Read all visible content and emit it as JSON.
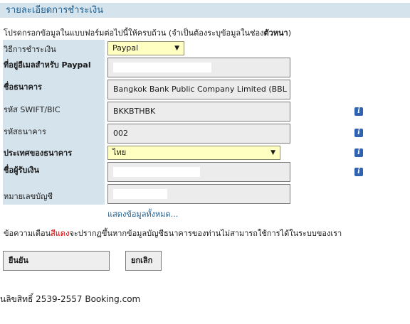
{
  "page": {
    "title": "รายละเอียดการชำระเงิน"
  },
  "instructions": {
    "text": "โปรดกรอกข้อมูลในแบบฟอร์มต่อไปนี้ให้ครบถ้วน (จำเป็นต้องระบุข้อมูลในช่อง",
    "emphasis": "ตัวหนา",
    "suffix": ")"
  },
  "form": {
    "payment_method": {
      "label": "วิธีการชำระเงิน",
      "value": "Paypal"
    },
    "paypal_email": {
      "label": "ที่อยู่อีเมลสำหรับ Paypal",
      "value": ""
    },
    "bank_name": {
      "label": "ชื่อธนาคาร",
      "value": "Bangkok Bank Public Company Limited (BBL"
    },
    "swift": {
      "label": "รหัส SWIFT/BIC",
      "value": "BKKBTHBK"
    },
    "bank_code": {
      "label": "รหัสธนาคาร",
      "value": "002"
    },
    "bank_country": {
      "label": "ประเทศของธนาคาร",
      "value": "ไทย"
    },
    "recipient": {
      "label": "ชื่อผู้รับเงิน",
      "value": ""
    },
    "account_number": {
      "label": "หมายเลขบัญชี",
      "value": ""
    }
  },
  "show_all_link": "แสดงข้อมูลทั้งหมด...",
  "warning": {
    "prefix": "ข้อความเตือน",
    "red": "สีแดง",
    "suffix": "จะปรากฏขึ้นหากข้อมูลบัญชีธนาคารของท่านไม่สามารถใช้การได้ในระบบของเรา"
  },
  "buttons": {
    "confirm": "ยืนยัน",
    "cancel": "ยกเลิก"
  },
  "footer": "นลิขสิทธิ์ 2539-2557 Booking.com",
  "icons": {
    "info": "info-icon",
    "dropdown": "chevron-down-icon"
  },
  "colors": {
    "label_bg": "#d5e3ec",
    "header_text": "#1f5f8f",
    "select_bg": "#ffffc2",
    "warning_red": "#cc0000"
  }
}
